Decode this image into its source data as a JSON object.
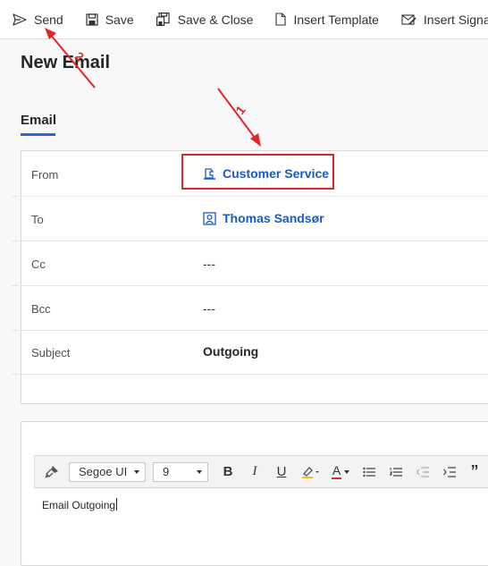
{
  "toolbar": {
    "send_label": "Send",
    "save_label": "Save",
    "save_close_label": "Save & Close",
    "insert_template_label": "Insert Template",
    "insert_signature_label": "Insert Signatu"
  },
  "page": {
    "title": "New Email"
  },
  "tabs": [
    {
      "label": "Email",
      "selected": true
    }
  ],
  "form": {
    "from": {
      "label": "From",
      "value": "Customer Service",
      "icon": "queue-icon"
    },
    "to": {
      "label": "To",
      "value": "Thomas Sandsør",
      "icon": "contact-icon"
    },
    "cc": {
      "label": "Cc",
      "value": "---"
    },
    "bcc": {
      "label": "Bcc",
      "value": "---"
    },
    "subject": {
      "label": "Subject",
      "value": "Outgoing"
    }
  },
  "editor": {
    "font_family": "Segoe UI",
    "font_size": "9",
    "bold": "B",
    "italic": "I",
    "underline": "U",
    "font_color": "A",
    "quote": "”",
    "content": "Email Outgoing"
  },
  "annotations": {
    "step1": "1",
    "step2": "2"
  },
  "colors": {
    "link": "#1a5bbf",
    "accent": "#2266e3",
    "annotation": "#e3242b"
  }
}
